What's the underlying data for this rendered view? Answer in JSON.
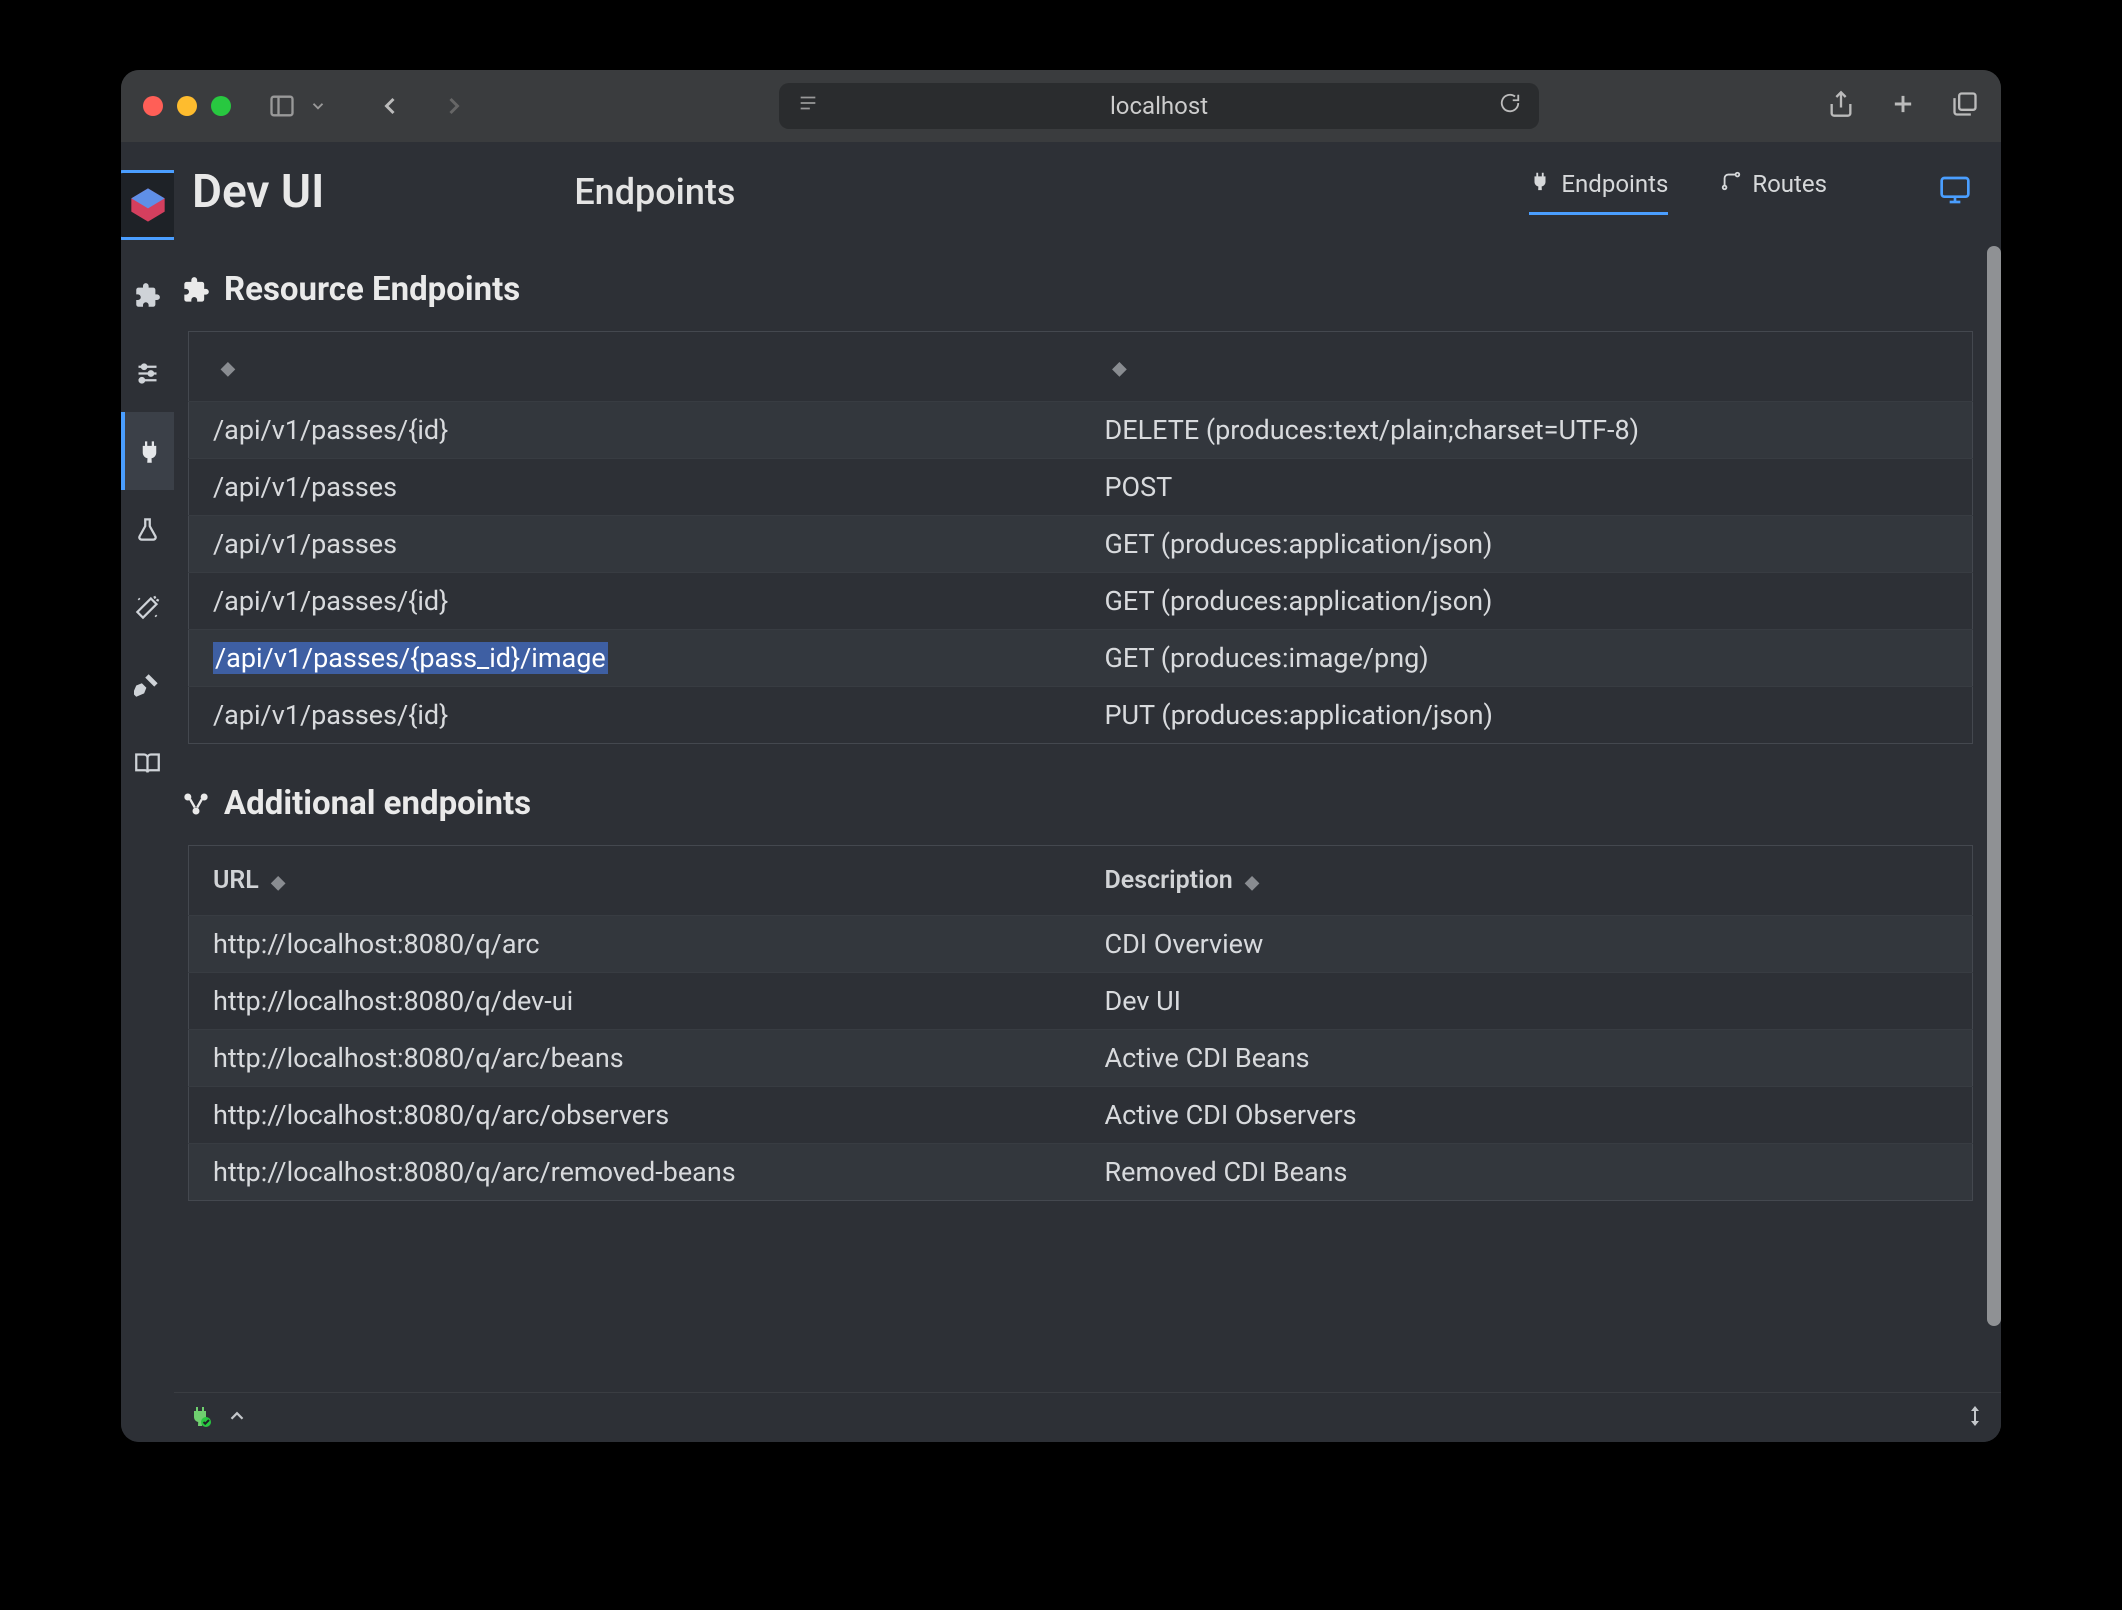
{
  "browser": {
    "address": "localhost"
  },
  "app": {
    "title": "Dev UI",
    "page_title": "Endpoints"
  },
  "tabs": [
    {
      "key": "endpoints",
      "label": "Endpoints",
      "active": true
    },
    {
      "key": "routes",
      "label": "Routes",
      "active": false
    }
  ],
  "sidebar": {
    "items": [
      {
        "key": "extensions",
        "icon": "puzzle-icon"
      },
      {
        "key": "config",
        "icon": "sliders-icon"
      },
      {
        "key": "endpoints",
        "icon": "plug-icon",
        "active": true
      },
      {
        "key": "tests",
        "icon": "flask-icon"
      },
      {
        "key": "magic",
        "icon": "wand-icon"
      },
      {
        "key": "build",
        "icon": "hammer-icon"
      },
      {
        "key": "docs",
        "icon": "book-icon"
      }
    ]
  },
  "sections": {
    "resource": {
      "title": "Resource Endpoints",
      "columns": [
        "",
        ""
      ],
      "rows": [
        {
          "path": "/api/v1/passes/{id}",
          "method": "DELETE (produces:text/plain;charset=UTF-8)",
          "highlighted": false
        },
        {
          "path": "/api/v1/passes",
          "method": "POST",
          "highlighted": false
        },
        {
          "path": "/api/v1/passes",
          "method": "GET (produces:application/json)",
          "highlighted": false
        },
        {
          "path": "/api/v1/passes/{id}",
          "method": "GET (produces:application/json)",
          "highlighted": false
        },
        {
          "path": "/api/v1/passes/{pass_id}/image",
          "method": "GET (produces:image/png)",
          "highlighted": true
        },
        {
          "path": "/api/v1/passes/{id}",
          "method": "PUT (produces:application/json)",
          "highlighted": false
        }
      ]
    },
    "additional": {
      "title": "Additional endpoints",
      "columns": [
        "URL",
        "Description"
      ],
      "rows": [
        {
          "url": "http://localhost:8080/q/arc",
          "desc": "CDI Overview"
        },
        {
          "url": "http://localhost:8080/q/dev-ui",
          "desc": "Dev UI"
        },
        {
          "url": "http://localhost:8080/q/arc/beans",
          "desc": "Active CDI Beans"
        },
        {
          "url": "http://localhost:8080/q/arc/observers",
          "desc": "Active CDI Observers"
        },
        {
          "url": "http://localhost:8080/q/arc/removed-beans",
          "desc": "Removed CDI Beans"
        }
      ]
    }
  },
  "colors": {
    "accent": "#4a9eff"
  }
}
